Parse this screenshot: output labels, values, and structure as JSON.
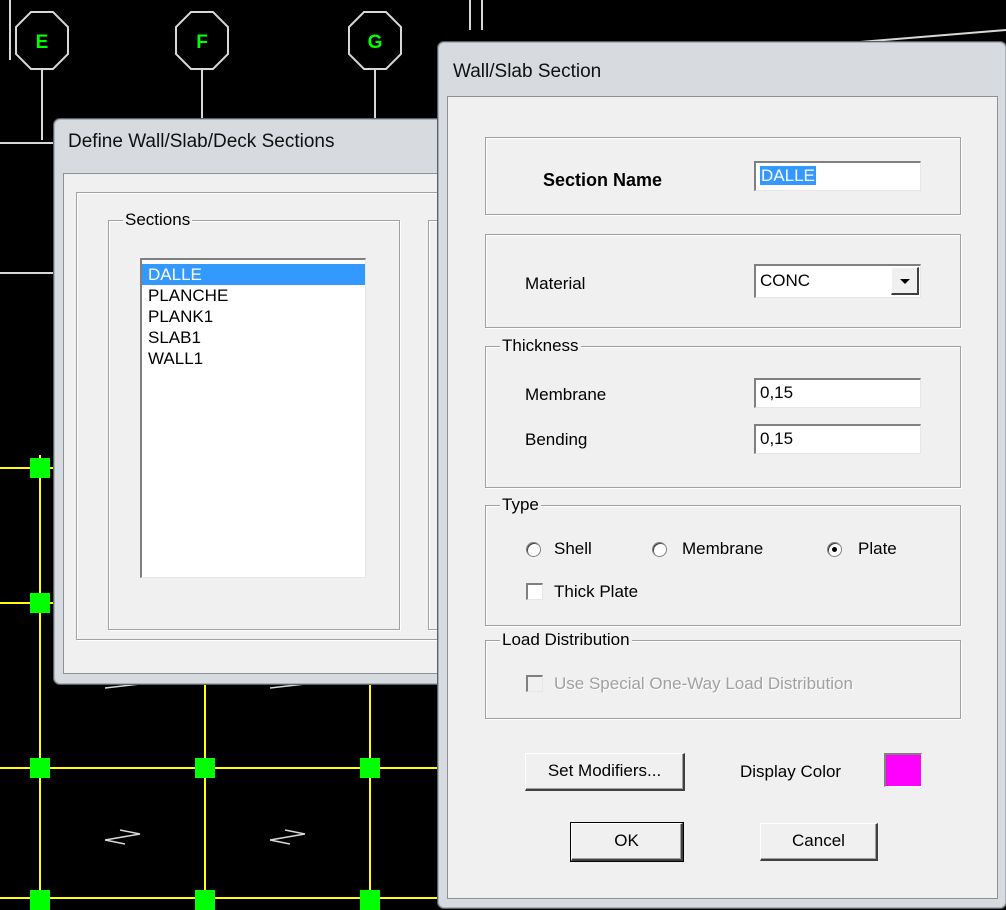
{
  "background": {
    "grid_bubbles": [
      "E",
      "F",
      "G"
    ],
    "colors": {
      "canvas": "#000000",
      "bubble": "#d8d8d8",
      "grid_line": "#ffff00",
      "node": "#00ff00"
    }
  },
  "define_dialog": {
    "title": "Define Wall/Slab/Deck Sections",
    "sections_group_label": "Sections",
    "sections": [
      {
        "label": "DALLE",
        "selected": true
      },
      {
        "label": "PLANCHE",
        "selected": false
      },
      {
        "label": "PLANK1",
        "selected": false
      },
      {
        "label": "SLAB1",
        "selected": false
      },
      {
        "label": "WALL1",
        "selected": false
      }
    ]
  },
  "section_dialog": {
    "title": "Wall/Slab Section",
    "section_name": {
      "label": "Section Name",
      "value": "DALLE"
    },
    "material": {
      "label": "Material",
      "value": "CONC"
    },
    "thickness": {
      "group_label": "Thickness",
      "membrane_label": "Membrane",
      "membrane_value": "0,15",
      "bending_label": "Bending",
      "bending_value": "0,15"
    },
    "type": {
      "group_label": "Type",
      "options": [
        {
          "label": "Shell",
          "selected": false
        },
        {
          "label": "Membrane",
          "selected": false
        },
        {
          "label": "Plate",
          "selected": true
        }
      ],
      "thick_plate_label": "Thick Plate",
      "thick_plate_checked": false
    },
    "load_distribution": {
      "group_label": "Load Distribution",
      "one_way_label": "Use Special One-Way Load Distribution",
      "enabled": false
    },
    "set_modifiers_label": "Set Modifiers...",
    "display_color_label": "Display Color",
    "display_color": "#ff00ff",
    "ok_label": "OK",
    "cancel_label": "Cancel"
  }
}
